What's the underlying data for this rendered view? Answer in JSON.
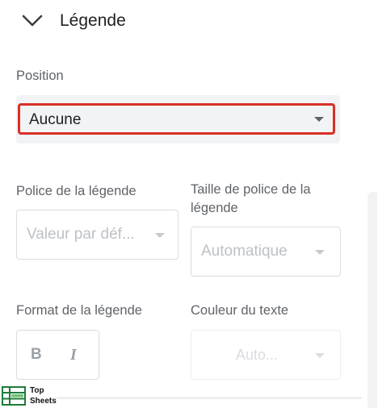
{
  "section": {
    "title": "Légende"
  },
  "position": {
    "label": "Position",
    "value": "Aucune"
  },
  "police": {
    "label": "Police de la légende",
    "placeholder": "Valeur par déf..."
  },
  "taille": {
    "label_line1": "Taille de police de la",
    "label_line2": "légende",
    "placeholder": "Automatique"
  },
  "format": {
    "label": "Format de la légende",
    "bold": "B",
    "italic": "I"
  },
  "couleur": {
    "label": "Couleur du texte",
    "placeholder": "Auto..."
  },
  "watermark": {
    "line1": "Top",
    "line2": "Sheets"
  },
  "colors": {
    "accent_red": "#d93025"
  }
}
